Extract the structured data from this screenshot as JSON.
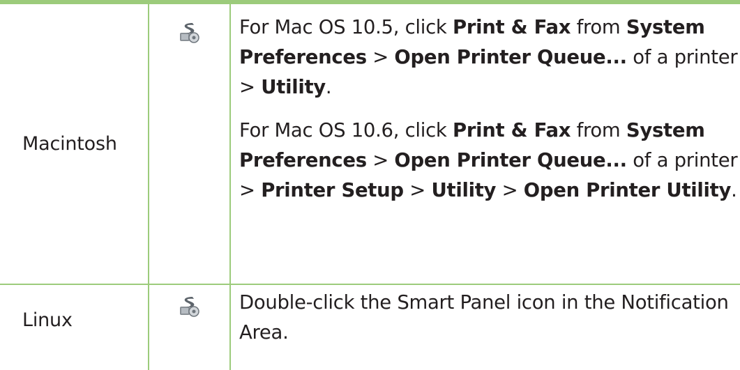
{
  "rows": [
    {
      "os": "Macintosh",
      "icon": "smart-panel-icon",
      "paragraphs": [
        {
          "p1": "For Mac OS 10.5, click ",
          "b1": "Print & Fax",
          "p2": " from ",
          "b2": "System Preferences",
          "p3": " > ",
          "b3": "Open Printer Queue...",
          "p4": " of a printer > ",
          "b4": "Utility",
          "p5": "."
        },
        {
          "p1": "For Mac OS 10.6, click ",
          "b1": "Print & Fax",
          "p2": " from ",
          "b2": "System Preferences",
          "p3": " > ",
          "b3": "Open Printer Queue...",
          "p4": " of a printer > ",
          "b4": "Printer Setup",
          "p5": " > ",
          "b5": "Utility",
          "p6": " > ",
          "b6": "Open Printer Utility",
          "p7": "."
        }
      ]
    },
    {
      "os": "Linux",
      "icon": "smart-panel-icon",
      "description": "Double-click the Smart Panel icon in the Notification Area."
    }
  ],
  "colors": {
    "rule": "#9ccb7b",
    "text": "#231f20"
  }
}
